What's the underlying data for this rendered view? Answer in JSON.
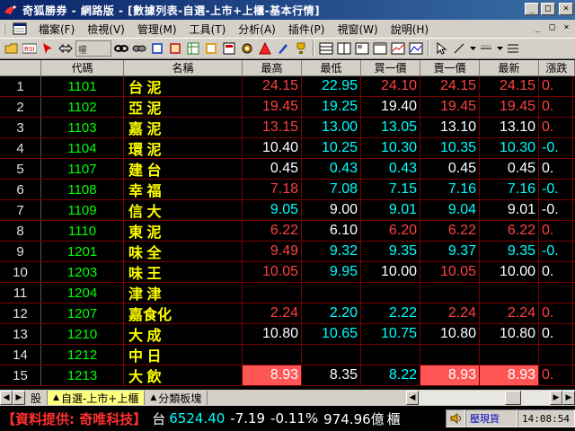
{
  "window": {
    "title": "奇狐勝券 - 網路版 - [數據列表-自選-上市+上櫃-基本行情]",
    "min": "_",
    "max": "□",
    "close": "×"
  },
  "menu": {
    "items": [
      "檔案(F)",
      "檢視(V)",
      "管理(M)",
      "工具(T)",
      "分析(A)",
      "插件(P)",
      "視窗(W)",
      "說明(H)"
    ],
    "right": [
      "_",
      "□",
      "×"
    ]
  },
  "toolbar": {
    "combo_label": "權"
  },
  "grid": {
    "headers": [
      "",
      "代碼",
      "名稱",
      "最高",
      "最低",
      "買一價",
      "賣一價",
      "最新",
      "漲跌"
    ],
    "rows": [
      {
        "idx": "1",
        "code": "1101",
        "name": "台 泥",
        "high": "24.15",
        "low": "22.95",
        "bid": "24.10",
        "ask": "24.15",
        "last": "24.15",
        "chg": "0.",
        "c": [
          "red",
          "cyan",
          "red",
          "red",
          "red",
          "red"
        ],
        "hl": [
          false,
          false,
          false,
          false,
          false
        ]
      },
      {
        "idx": "2",
        "code": "1102",
        "name": "亞 泥",
        "high": "19.45",
        "low": "19.25",
        "bid": "19.40",
        "ask": "19.45",
        "last": "19.45",
        "chg": "0.",
        "c": [
          "red",
          "cyan",
          "white",
          "red",
          "red",
          "red"
        ],
        "hl": [
          false,
          false,
          false,
          false,
          false
        ]
      },
      {
        "idx": "3",
        "code": "1103",
        "name": "嘉 泥",
        "high": "13.15",
        "low": "13.00",
        "bid": "13.05",
        "ask": "13.10",
        "last": "13.10",
        "chg": "0.",
        "c": [
          "red",
          "cyan",
          "cyan",
          "white",
          "white",
          "red"
        ],
        "hl": [
          false,
          false,
          false,
          false,
          false
        ]
      },
      {
        "idx": "4",
        "code": "1104",
        "name": "環 泥",
        "high": "10.40",
        "low": "10.25",
        "bid": "10.30",
        "ask": "10.35",
        "last": "10.30",
        "chg": "-0.",
        "c": [
          "white",
          "cyan",
          "cyan",
          "cyan",
          "cyan",
          "cyan"
        ],
        "hl": [
          false,
          false,
          false,
          false,
          false
        ]
      },
      {
        "idx": "5",
        "code": "1107",
        "name": "建 台",
        "high": "0.45",
        "low": "0.43",
        "bid": "0.43",
        "ask": "0.45",
        "last": "0.45",
        "chg": "0.",
        "c": [
          "white",
          "cyan",
          "cyan",
          "white",
          "white",
          "white"
        ],
        "hl": [
          false,
          false,
          false,
          false,
          false
        ]
      },
      {
        "idx": "6",
        "code": "1108",
        "name": "幸 福",
        "high": "7.18",
        "low": "7.08",
        "bid": "7.15",
        "ask": "7.16",
        "last": "7.16",
        "chg": "-0.",
        "c": [
          "red",
          "cyan",
          "cyan",
          "cyan",
          "cyan",
          "cyan"
        ],
        "hl": [
          false,
          false,
          false,
          false,
          false
        ]
      },
      {
        "idx": "7",
        "code": "1109",
        "name": "信 大",
        "high": "9.05",
        "low": "9.00",
        "bid": "9.01",
        "ask": "9.04",
        "last": "9.01",
        "chg": "-0.",
        "c": [
          "cyan",
          "white",
          "cyan",
          "cyan",
          "white",
          "white"
        ],
        "hl": [
          false,
          false,
          false,
          false,
          false
        ]
      },
      {
        "idx": "8",
        "code": "1110",
        "name": "東 泥",
        "high": "6.22",
        "low": "6.10",
        "bid": "6.20",
        "ask": "6.22",
        "last": "6.22",
        "chg": "0.",
        "c": [
          "red",
          "white",
          "red",
          "red",
          "red",
          "red"
        ],
        "hl": [
          false,
          false,
          false,
          false,
          false
        ]
      },
      {
        "idx": "9",
        "code": "1201",
        "name": "味 全",
        "high": "9.49",
        "low": "9.32",
        "bid": "9.35",
        "ask": "9.37",
        "last": "9.35",
        "chg": "-0.",
        "c": [
          "red",
          "cyan",
          "cyan",
          "cyan",
          "cyan",
          "cyan"
        ],
        "hl": [
          false,
          false,
          false,
          false,
          false
        ]
      },
      {
        "idx": "10",
        "code": "1203",
        "name": "味 王",
        "high": "10.05",
        "low": "9.95",
        "bid": "10.00",
        "ask": "10.05",
        "last": "10.00",
        "chg": "0.",
        "c": [
          "red",
          "cyan",
          "white",
          "red",
          "white",
          "white"
        ],
        "hl": [
          false,
          false,
          false,
          false,
          false
        ]
      },
      {
        "idx": "11",
        "code": "1204",
        "name": "津 津",
        "high": "",
        "low": "",
        "bid": "",
        "ask": "",
        "last": "",
        "chg": "",
        "c": [
          "white",
          "white",
          "white",
          "white",
          "white",
          "white"
        ],
        "hl": [
          false,
          false,
          false,
          false,
          false
        ]
      },
      {
        "idx": "12",
        "code": "1207",
        "name": "嘉食化",
        "high": "2.24",
        "low": "2.20",
        "bid": "2.22",
        "ask": "2.24",
        "last": "2.24",
        "chg": "0.",
        "c": [
          "red",
          "cyan",
          "cyan",
          "red",
          "red",
          "red"
        ],
        "hl": [
          false,
          false,
          false,
          false,
          false
        ]
      },
      {
        "idx": "13",
        "code": "1210",
        "name": "大 成",
        "high": "10.80",
        "low": "10.65",
        "bid": "10.75",
        "ask": "10.80",
        "last": "10.80",
        "chg": "0.",
        "c": [
          "white",
          "cyan",
          "cyan",
          "white",
          "white",
          "white"
        ],
        "hl": [
          false,
          false,
          false,
          false,
          false
        ]
      },
      {
        "idx": "14",
        "code": "1212",
        "name": "中 日",
        "high": "",
        "low": "",
        "bid": "",
        "ask": "",
        "last": "",
        "chg": "",
        "c": [
          "white",
          "white",
          "white",
          "white",
          "white",
          "white"
        ],
        "hl": [
          false,
          false,
          false,
          false,
          false
        ]
      },
      {
        "idx": "15",
        "code": "1213",
        "name": "大 飲",
        "high": "8.93",
        "low": "8.35",
        "bid": "8.22",
        "ask": "8.93",
        "last": "8.93",
        "chg": "0.",
        "c": [
          "white",
          "white",
          "cyan",
          "white",
          "white",
          "red"
        ],
        "hl": [
          true,
          false,
          false,
          true,
          true
        ]
      }
    ]
  },
  "tabs": {
    "items": [
      {
        "label": "股",
        "active": false,
        "tri": ""
      },
      {
        "label": "自選-上市+上櫃",
        "active": true,
        "tri": "▲"
      },
      {
        "label": "分類板塊",
        "active": false,
        "tri": "▲"
      }
    ]
  },
  "status": {
    "provider": "【資料提供: 奇唯科技】",
    "market": "台",
    "index": "6524.40",
    "change": "-7.19",
    "percent": "-0.11%",
    "volume": "974.96億",
    "unit": "櫃",
    "mode": "壓現貨",
    "time": "14:08:54"
  },
  "colors": {
    "titlebar_start": "#0a246a",
    "titlebar_end": "#3a6ea5",
    "up": "#ff4040",
    "down": "#00ffff",
    "flat": "#ffffff",
    "code": "#00ff00",
    "name": "#ffff00",
    "grid_line": "#7a0000",
    "highlight": "#ff5555"
  }
}
